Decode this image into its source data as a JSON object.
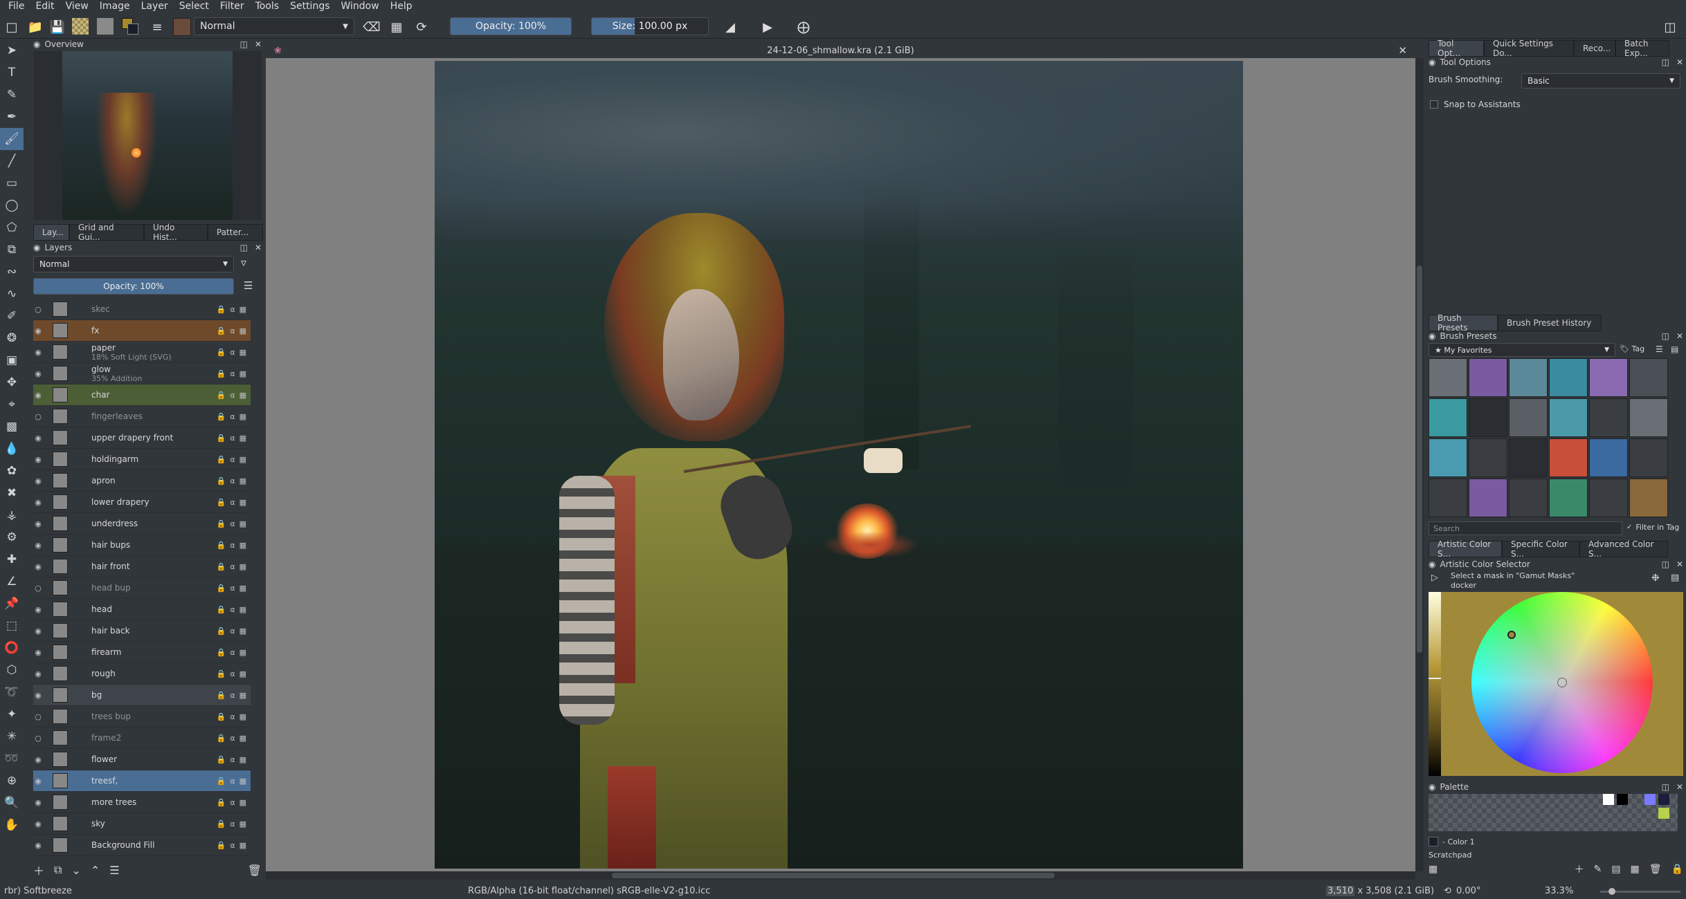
{
  "menu": [
    "File",
    "Edit",
    "View",
    "Image",
    "Layer",
    "Select",
    "Filter",
    "Tools",
    "Settings",
    "Window",
    "Help"
  ],
  "toolbar": {
    "blend_mode": "Normal",
    "opacity_label": "Opacity: 100%",
    "opacity_value": 1.0,
    "size_label": "Size: 100.00 px",
    "size_value": 0.37
  },
  "overview": {
    "title": "Overview"
  },
  "left_tabs": [
    "Lay...",
    "Grid and Gui...",
    "Undo Hist...",
    "Patter..."
  ],
  "layers_panel": {
    "title": "Layers",
    "blend_mode": "Normal",
    "opacity_label": "Opacity:  100%",
    "opacity_value": 1.0,
    "layers": [
      {
        "name": "skec",
        "sub": "",
        "visible": false,
        "color": "#31363b"
      },
      {
        "name": "fx",
        "sub": "",
        "visible": true,
        "color": "#6e4a2b"
      },
      {
        "name": "paper",
        "sub": "18% Soft Light (SVG)",
        "visible": true,
        "color": "#31363b"
      },
      {
        "name": "glow",
        "sub": "35% Addition",
        "visible": true,
        "color": "#31363b"
      },
      {
        "name": "char",
        "sub": "",
        "visible": true,
        "color": "#4c5e36"
      },
      {
        "name": "fingerleaves",
        "sub": "",
        "visible": false,
        "color": "#31363b"
      },
      {
        "name": "upper drapery front",
        "sub": "",
        "visible": true,
        "color": "#31363b"
      },
      {
        "name": "holdingarm",
        "sub": "",
        "visible": true,
        "color": "#31363b"
      },
      {
        "name": "apron",
        "sub": "",
        "visible": true,
        "color": "#31363b"
      },
      {
        "name": "lower drapery",
        "sub": "",
        "visible": true,
        "color": "#31363b"
      },
      {
        "name": "underdress",
        "sub": "",
        "visible": true,
        "color": "#31363b"
      },
      {
        "name": "hair bups",
        "sub": "",
        "visible": true,
        "color": "#31363b"
      },
      {
        "name": "hair front",
        "sub": "",
        "visible": true,
        "color": "#31363b"
      },
      {
        "name": "head bup",
        "sub": "",
        "visible": false,
        "color": "#31363b"
      },
      {
        "name": "head",
        "sub": "",
        "visible": true,
        "color": "#31363b"
      },
      {
        "name": "hair back",
        "sub": "",
        "visible": true,
        "color": "#31363b"
      },
      {
        "name": "firearm",
        "sub": "",
        "visible": true,
        "color": "#31363b"
      },
      {
        "name": "rough",
        "sub": "",
        "visible": true,
        "color": "#31363b"
      },
      {
        "name": "bg",
        "sub": "",
        "visible": true,
        "color": "#3e444a"
      },
      {
        "name": "trees bup",
        "sub": "",
        "visible": false,
        "color": "#31363b"
      },
      {
        "name": "frame2",
        "sub": "",
        "visible": false,
        "color": "#31363b"
      },
      {
        "name": "flower",
        "sub": "",
        "visible": true,
        "color": "#31363b"
      },
      {
        "name": "treesf,",
        "sub": "",
        "visible": true,
        "color": "#4a6d94"
      },
      {
        "name": "more trees",
        "sub": "",
        "visible": true,
        "color": "#31363b"
      },
      {
        "name": "sky",
        "sub": "",
        "visible": true,
        "color": "#31363b"
      },
      {
        "name": "Background Fill",
        "sub": "",
        "visible": true,
        "color": "#31363b"
      }
    ]
  },
  "document": {
    "title": "24-12-06_shmallow.kra (2.1 GiB)"
  },
  "right_tabs_top": [
    "Tool Opt...",
    "Quick Settings Do...",
    "Reco...",
    "Batch Exp..."
  ],
  "tool_options": {
    "title": "Tool Options",
    "smoothing_label": "Brush Smoothing:",
    "smoothing_value": "Basic",
    "snap_label": "Snap to Assistants"
  },
  "brush_tabs": [
    "Brush Presets",
    "Brush Preset History"
  ],
  "brush_presets": {
    "title": "Brush Presets",
    "tag": "★ My Favorites",
    "tag_button": "Tag",
    "search_placeholder": "Search",
    "filter_label": "Filter in Tag"
  },
  "color_tabs": [
    "Artistic Color S...",
    "Specific Color S...",
    "Advanced Color S..."
  ],
  "color_selector": {
    "title": "Artistic Color Selector",
    "hint": "Select a mask in \"Gamut Masks\" docker"
  },
  "palette": {
    "title": "Palette",
    "color_name": "- Color 1",
    "scratchpad": "Scratchpad"
  },
  "status": {
    "brush": "rbr) Softbreeze",
    "color_info": "RGB/Alpha (16-bit float/channel)  sRGB-elle-V2-g10.icc",
    "size_w": "3,510",
    "size_rest": " x 3,508 (2.1 GiB)",
    "rotation": "0.00°",
    "zoom": "33.3%"
  }
}
